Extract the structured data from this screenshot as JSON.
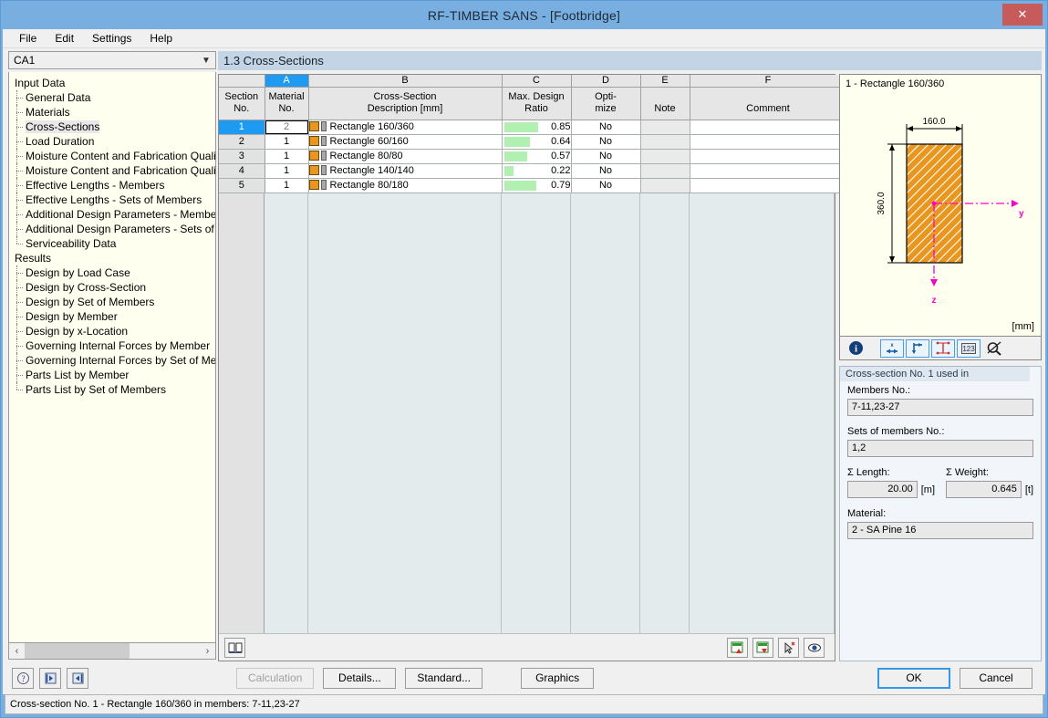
{
  "window": {
    "title": "RF-TIMBER SANS - [Footbridge]",
    "close_label": "✕"
  },
  "menu": {
    "items": [
      {
        "label": "File"
      },
      {
        "label": "Edit"
      },
      {
        "label": "Settings"
      },
      {
        "label": "Help"
      }
    ]
  },
  "sidebar": {
    "combo_value": "CA1",
    "combo_arrow": "chevron-down-icon",
    "groups": [
      {
        "label": "Input Data",
        "items": [
          {
            "label": "General Data"
          },
          {
            "label": "Materials"
          },
          {
            "label": "Cross-Sections"
          },
          {
            "label": "Load Duration"
          },
          {
            "label": "Moisture Content and Fabrication Quality"
          },
          {
            "label": "Moisture Content and Fabrication Quality"
          },
          {
            "label": "Effective Lengths - Members"
          },
          {
            "label": "Effective Lengths - Sets of Members"
          },
          {
            "label": "Additional Design Parameters - Members"
          },
          {
            "label": "Additional Design Parameters - Sets of Me"
          },
          {
            "label": "Serviceability Data"
          }
        ]
      },
      {
        "label": "Results",
        "items": [
          {
            "label": "Design by Load Case"
          },
          {
            "label": "Design by Cross-Section"
          },
          {
            "label": "Design by Set of Members"
          },
          {
            "label": "Design by Member"
          },
          {
            "label": "Design by x-Location"
          },
          {
            "label": "Governing Internal Forces by Member"
          },
          {
            "label": "Governing Internal Forces by Set of Mem"
          },
          {
            "label": "Parts List by Member"
          },
          {
            "label": "Parts List by Set of Members"
          }
        ]
      }
    ],
    "selected_item": "Cross-Sections",
    "scroll_left_arrow": "‹",
    "scroll_right_arrow": "›"
  },
  "main": {
    "section_title": "1.3 Cross-Sections",
    "table": {
      "column_letters": [
        "",
        "A",
        "B",
        "C",
        "D",
        "E",
        "F"
      ],
      "active_column_letter": "A",
      "headers": [
        {
          "line1": "Section",
          "line2": "No."
        },
        {
          "line1": "Material",
          "line2": "No."
        },
        {
          "line1": "Cross-Section",
          "line2": "Description [mm]"
        },
        {
          "line1": "Max. Design",
          "line2": "Ratio"
        },
        {
          "line1": "Opti-",
          "line2": "mize"
        },
        {
          "line1": "",
          "line2": "Note"
        },
        {
          "line1": "",
          "line2": "Comment"
        }
      ],
      "rows": [
        {
          "section_no": "1",
          "material_no": "2",
          "description": "Rectangle 160/360",
          "ratio": "0.85",
          "ratio_value": 0.85,
          "optimize": "No",
          "note": "",
          "comment": "",
          "selected": true
        },
        {
          "section_no": "2",
          "material_no": "1",
          "description": "Rectangle 60/160",
          "ratio": "0.64",
          "ratio_value": 0.64,
          "optimize": "No",
          "note": "",
          "comment": "",
          "selected": false
        },
        {
          "section_no": "3",
          "material_no": "1",
          "description": "Rectangle 80/80",
          "ratio": "0.57",
          "ratio_value": 0.57,
          "optimize": "No",
          "note": "",
          "comment": "",
          "selected": false
        },
        {
          "section_no": "4",
          "material_no": "1",
          "description": "Rectangle 140/140",
          "ratio": "0.22",
          "ratio_value": 0.22,
          "optimize": "No",
          "note": "",
          "comment": "",
          "selected": false
        },
        {
          "section_no": "5",
          "material_no": "1",
          "description": "Rectangle 80/180",
          "ratio": "0.79",
          "ratio_value": 0.79,
          "optimize": "No",
          "note": "",
          "comment": "",
          "selected": false
        }
      ]
    },
    "toolbar": {
      "left_buttons": [
        {
          "icon": "book-icon"
        }
      ],
      "right_buttons": [
        {
          "icon": "export-excel-up-icon"
        },
        {
          "icon": "import-excel-down-icon"
        },
        {
          "icon": "pick-select-icon"
        },
        {
          "icon": "eye-view-icon"
        }
      ]
    }
  },
  "preview": {
    "title": "1 - Rectangle 160/360",
    "unit": "[mm]",
    "dim_width": "160.0",
    "dim_height": "360.0",
    "axis_y": "y",
    "axis_z": "z",
    "section_fill": "#e8961e",
    "axis_color": "#ff00c8",
    "toolbar": [
      {
        "icon": "info-icon",
        "framed": false
      },
      {
        "icon": "dimension-x-icon",
        "framed": true
      },
      {
        "icon": "axes-icon",
        "framed": true
      },
      {
        "icon": "dimension-lines-icon",
        "framed": true
      },
      {
        "icon": "numbers-123-icon",
        "framed": true
      },
      {
        "icon": "zoom-off-icon",
        "framed": false
      }
    ]
  },
  "info_panel": {
    "legend": "Cross-section No. 1 used in",
    "members_label": "Members No.:",
    "members_value": "7-11,23-27",
    "sets_label": "Sets of members No.:",
    "sets_value": "1,2",
    "length_label": "Σ Length:",
    "length_value": "20.00",
    "length_unit": "[m]",
    "weight_label": "Σ Weight:",
    "weight_value": "0.645",
    "weight_unit": "[t]",
    "material_label": "Material:",
    "material_value": "2 - SA Pine 16"
  },
  "bottom": {
    "help_icon": "help-question-icon",
    "prev_icon": "previous-window-icon",
    "next_icon": "next-window-icon",
    "calculation_label": "Calculation",
    "details_label": "Details...",
    "standard_label": "Standard...",
    "graphics_label": "Graphics",
    "ok_label": "OK",
    "cancel_label": "Cancel"
  },
  "statusbar": {
    "text": "Cross-section No. 1 - Rectangle 160/360 in members: 7-11,23-27"
  }
}
